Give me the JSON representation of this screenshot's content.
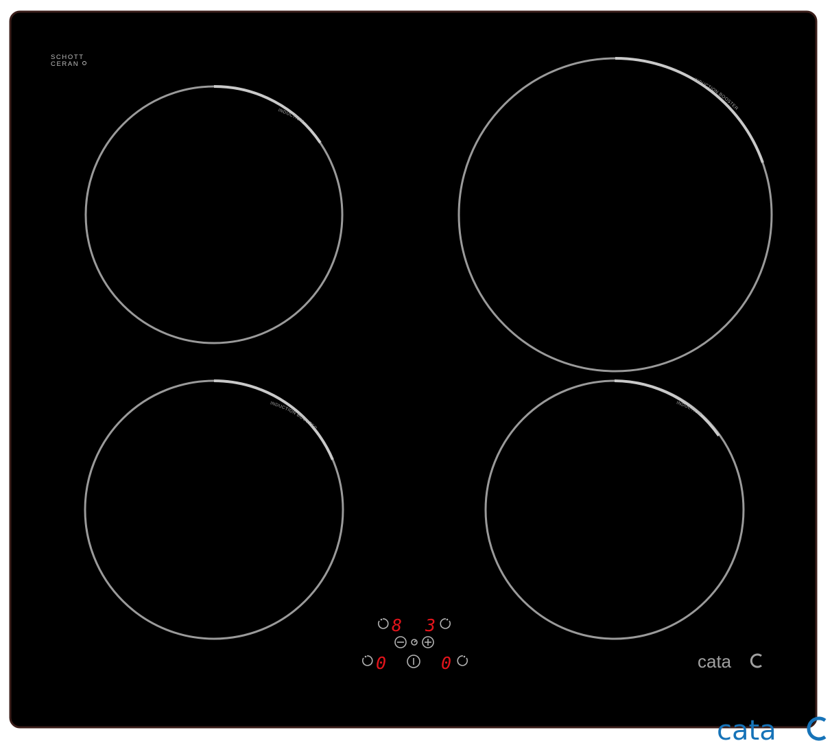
{
  "glass_brand": {
    "line1": "SCHOTT",
    "line2": "CERAN"
  },
  "zones": {
    "rear_left": {
      "label": "INDUCTION"
    },
    "rear_right": {
      "label": "INDUCTION BOOSTER"
    },
    "front_left": {
      "label": "INDUCTION BOOSTER"
    },
    "front_right": {
      "label": "INDUCTION"
    }
  },
  "control_panel": {
    "rear_left_level": "8",
    "rear_right_level": "3",
    "front_left_level": "0",
    "front_right_level": "0"
  },
  "brand": {
    "name": "cata",
    "corner_name": "cata"
  },
  "colors": {
    "glass": "#000000",
    "frame": "#3a1e1a",
    "ring": "#9a9a9a",
    "display": "#e3141b",
    "corner_logo": "#1673b8"
  }
}
